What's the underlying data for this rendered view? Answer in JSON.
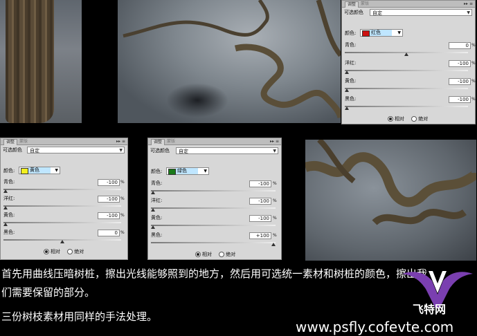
{
  "panels": [
    {
      "tabs": [
        "调整",
        "蒙版"
      ],
      "title": "可选颜色",
      "preset": "自定",
      "color_label": "颜色:",
      "color_name": "红色",
      "swatch": "#cc1111",
      "sliders": [
        {
          "label": "青色:",
          "value": "0",
          "unit": "%",
          "level": 0.5
        },
        {
          "label": "洋红:",
          "value": "-100",
          "unit": "%",
          "level": 0.0
        },
        {
          "label": "黄色:",
          "value": "-100",
          "unit": "%",
          "level": 0.0
        },
        {
          "label": "黑色:",
          "value": "-100",
          "unit": "%",
          "level": 0.0
        }
      ],
      "radio_relative": "相对",
      "radio_absolute": "绝对",
      "selected": "relative"
    },
    {
      "tabs": [
        "调整",
        "蒙版"
      ],
      "title": "可选颜色",
      "preset": "自定",
      "color_label": "颜色:",
      "color_name": "黄色",
      "swatch": "#f2f020",
      "sliders": [
        {
          "label": "青色:",
          "value": "-100",
          "unit": "%",
          "level": 0.0
        },
        {
          "label": "洋红:",
          "value": "-100",
          "unit": "%",
          "level": 0.0
        },
        {
          "label": "黄色:",
          "value": "-100",
          "unit": "%",
          "level": 0.0
        },
        {
          "label": "黑色:",
          "value": "0",
          "unit": "%",
          "level": 0.5
        }
      ],
      "radio_relative": "相对",
      "radio_absolute": "绝对",
      "selected": "relative"
    },
    {
      "tabs": [
        "调整",
        "蒙版"
      ],
      "title": "可选颜色",
      "preset": "自定",
      "color_label": "颜色:",
      "color_name": "绿色",
      "swatch": "#1a7a1a",
      "sliders": [
        {
          "label": "青色:",
          "value": "-100",
          "unit": "%",
          "level": 0.0
        },
        {
          "label": "洋红:",
          "value": "-100",
          "unit": "%",
          "level": 0.0
        },
        {
          "label": "黄色:",
          "value": "-100",
          "unit": "%",
          "level": 0.0
        },
        {
          "label": "黑色:",
          "value": "+100",
          "unit": "%",
          "level": 1.0
        }
      ],
      "radio_relative": "相对",
      "radio_absolute": "绝对",
      "selected": "relative"
    }
  ],
  "caption": {
    "line1": "首先用曲线压暗树桩，擦出光线能够照到的地方，然后用可选统一素材和树桩的颜色，擦出我",
    "line2": "们需要保留的部分。",
    "line3": "三份树枝素材用同样的手法处理。"
  },
  "watermark": {
    "url": "www.psfly.cofevte.com",
    "logo_text": "飞特网"
  }
}
